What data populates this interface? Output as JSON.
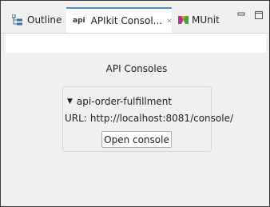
{
  "tabs": [
    {
      "label": "Outline",
      "icon": "outline-icon",
      "active": false
    },
    {
      "label": "APIkit Consol...",
      "icon": "api-icon",
      "icon_text": "api",
      "active": true,
      "closable": true
    },
    {
      "label": "MUnit",
      "icon": "munit-icon",
      "active": false
    }
  ],
  "window_controls": [
    "minimize-icon",
    "maximize-icon"
  ],
  "main": {
    "heading": "API Consoles",
    "group": {
      "title": "api-order-fulfillment",
      "expanded": true,
      "url_label": "URL:",
      "url_value": "http://localhost:8081/console/",
      "button_label": "Open console"
    }
  },
  "colors": {
    "active_tab_border": "#4a90d9",
    "background": "#f0f0f0",
    "munit_green": "#3fa535",
    "munit_orange": "#f28c28",
    "munit_purple": "#a53a8b"
  }
}
